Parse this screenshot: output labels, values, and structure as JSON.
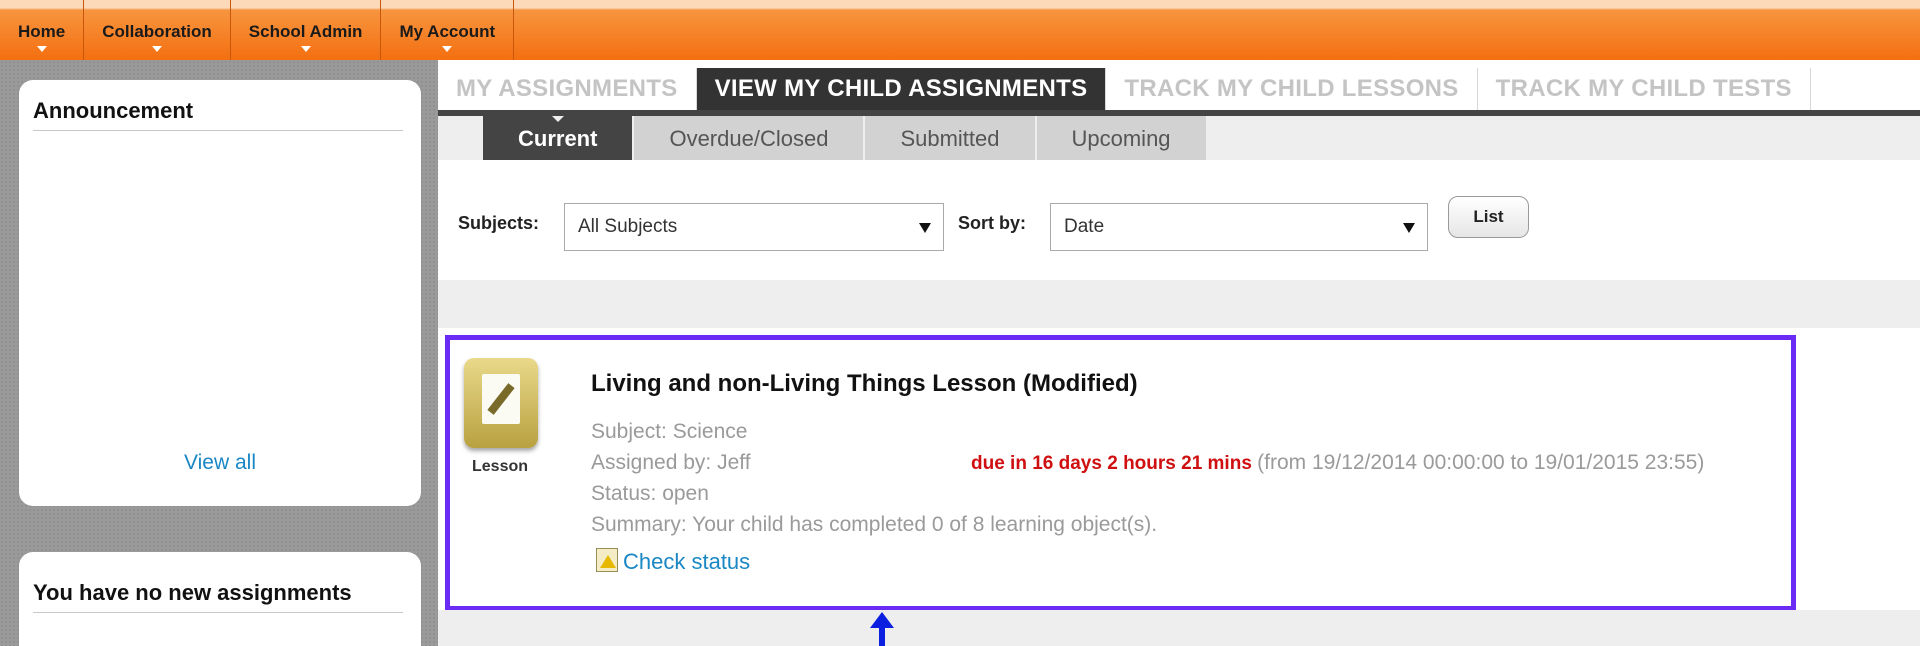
{
  "nav": {
    "items": [
      {
        "label": "Home"
      },
      {
        "label": "Collaboration"
      },
      {
        "label": "School Admin"
      },
      {
        "label": "My Account"
      }
    ]
  },
  "sidebar": {
    "announcement_title": "Announcement",
    "view_all": "View all",
    "assignments_title": "You have no new assignments"
  },
  "tabs": [
    {
      "label": "MY ASSIGNMENTS",
      "active": false
    },
    {
      "label": "VIEW MY CHILD ASSIGNMENTS",
      "active": true
    },
    {
      "label": "TRACK MY CHILD LESSONS",
      "active": false
    },
    {
      "label": "TRACK MY CHILD TESTS",
      "active": false
    }
  ],
  "subtabs": [
    {
      "label": "Current",
      "active": true
    },
    {
      "label": "Overdue/Closed",
      "active": false
    },
    {
      "label": "Submitted",
      "active": false
    },
    {
      "label": "Upcoming",
      "active": false
    }
  ],
  "filters": {
    "subjects_label": "Subjects:",
    "subjects_value": "All Subjects",
    "sort_label": "Sort by:",
    "sort_value": "Date",
    "list_button": "List"
  },
  "assignment": {
    "type_label": "Lesson",
    "icon": "lesson-icon",
    "title": "Living and non-Living Things Lesson (Modified)",
    "subject": "Subject: Science",
    "assigned_by": "Assigned by: Jeff",
    "due": "due in 16 days 2 hours 21 mins",
    "range": "(from 19/12/2014 00:00:00 to 19/01/2015 23:55)",
    "status": "Status: open",
    "summary": "Summary: Your child has completed 0 of 8 learning object(s).",
    "check_status": "Check status"
  },
  "colors": {
    "nav_orange": "#f46f10",
    "highlight_border": "#6a2cf5",
    "link_blue": "#1a87c5",
    "due_red": "#d01010",
    "pointer_arrow": "#0a1fe0"
  }
}
